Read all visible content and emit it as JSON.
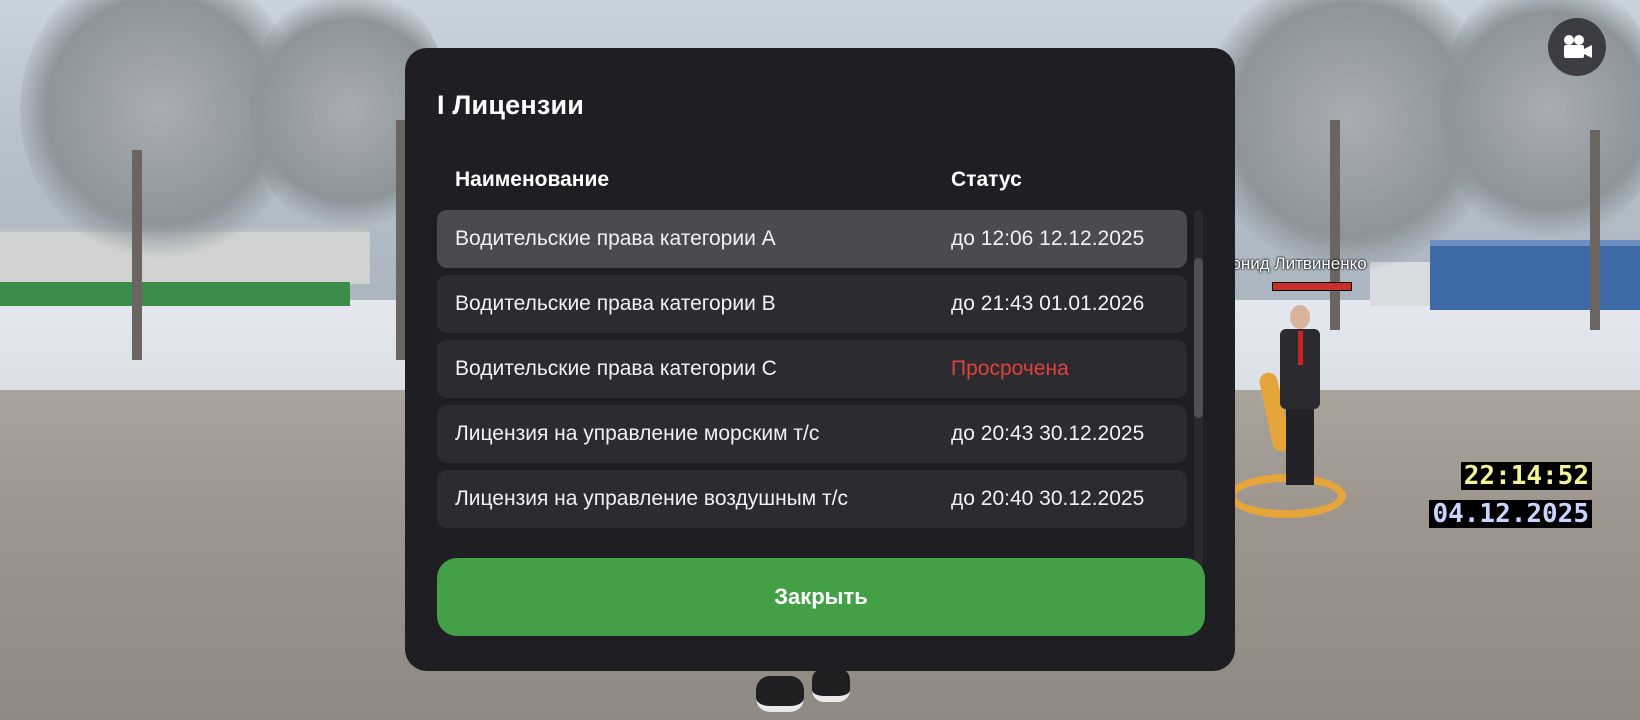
{
  "modal": {
    "title": "I Лицензии",
    "columns": {
      "name": "Наименование",
      "status": "Статус"
    },
    "rows": [
      {
        "name": "Водительские права категории A",
        "status": "до 12:06 12.12.2025",
        "selected": true,
        "expired": false
      },
      {
        "name": "Водительские права категории B",
        "status": "до 21:43 01.01.2026",
        "selected": false,
        "expired": false
      },
      {
        "name": "Водительские права категории C",
        "status": "Просрочена",
        "selected": false,
        "expired": true
      },
      {
        "name": "Лицензия на управление морским т/с",
        "status": "до 20:43 30.12.2025",
        "selected": false,
        "expired": false
      },
      {
        "name": "Лицензия на управление воздушным т/с",
        "status": "до 20:40 30.12.2025",
        "selected": false,
        "expired": false
      }
    ],
    "close_label": "Закрыть"
  },
  "hud": {
    "time": "22:14:52",
    "date": "04.12.2025",
    "player_name": "еонид Литвиненко",
    "camera_icon": "video-camera-icon"
  },
  "colors": {
    "modal_bg": "#1f1f23",
    "row_bg": "#2b2b30",
    "row_selected_bg": "#4a4a50",
    "expired_text": "#e0413c",
    "close_button": "#43a047",
    "hud_time": "#f4f29a",
    "hud_date": "#c9d4ff"
  }
}
